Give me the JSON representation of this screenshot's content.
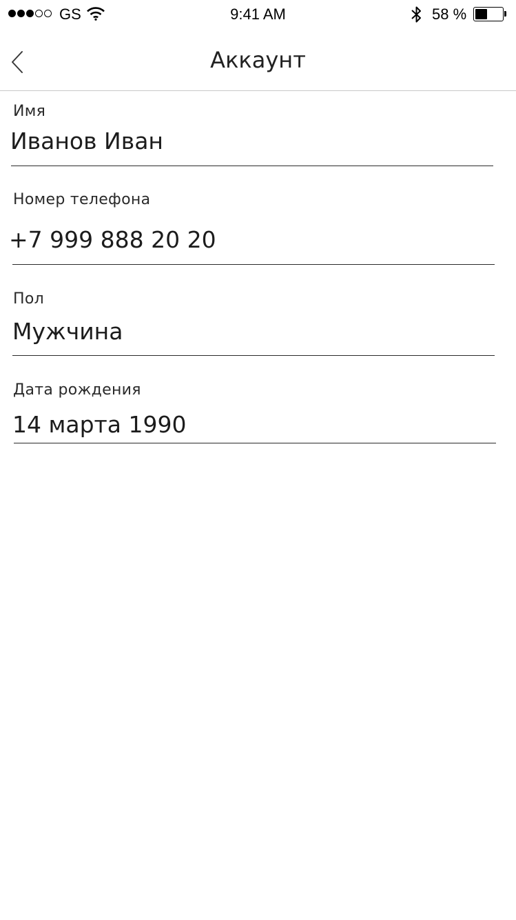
{
  "status_bar": {
    "carrier": "GS",
    "time": "9:41 AM",
    "battery_percent": "58 %",
    "battery_level": 0.45
  },
  "nav": {
    "title": "Аккаунт"
  },
  "fields": [
    {
      "label": "Имя",
      "value": "Иванов Иван"
    },
    {
      "label": "Номер телефона",
      "value": "+7 999 888 20 20"
    },
    {
      "label": "Пол",
      "value": "Мужчина"
    },
    {
      "label": "Дата рождения",
      "value": "14 марта 1990"
    }
  ]
}
